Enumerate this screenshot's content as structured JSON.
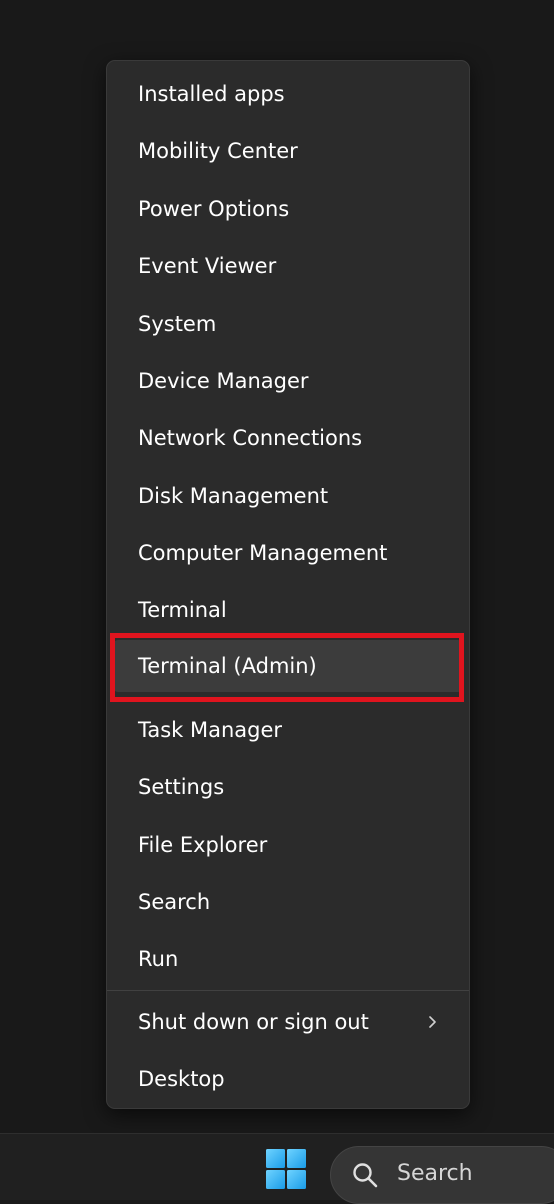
{
  "context_menu": {
    "items": [
      {
        "label": "Installed apps"
      },
      {
        "label": "Mobility Center"
      },
      {
        "label": "Power Options"
      },
      {
        "label": "Event Viewer"
      },
      {
        "label": "System"
      },
      {
        "label": "Device Manager"
      },
      {
        "label": "Network Connections"
      },
      {
        "label": "Disk Management"
      },
      {
        "label": "Computer Management"
      },
      {
        "label": "Terminal"
      },
      {
        "label": "Terminal (Admin)",
        "highlighted": true
      },
      {
        "label": "Task Manager"
      },
      {
        "label": "Settings"
      },
      {
        "label": "File Explorer"
      },
      {
        "label": "Search"
      },
      {
        "label": "Run"
      }
    ],
    "footer_items": [
      {
        "label": "Shut down or sign out",
        "has_submenu": true,
        "icon": "chevron-right-icon"
      },
      {
        "label": "Desktop"
      }
    ]
  },
  "taskbar": {
    "start_icon": "windows-logo-icon",
    "search_label": "Search",
    "search_icon": "search-icon"
  },
  "colors": {
    "menu_background": "#2b2b2b",
    "highlight_border": "#e0141e",
    "text": "#ffffff",
    "windows_logo": "#4cc2ff"
  }
}
